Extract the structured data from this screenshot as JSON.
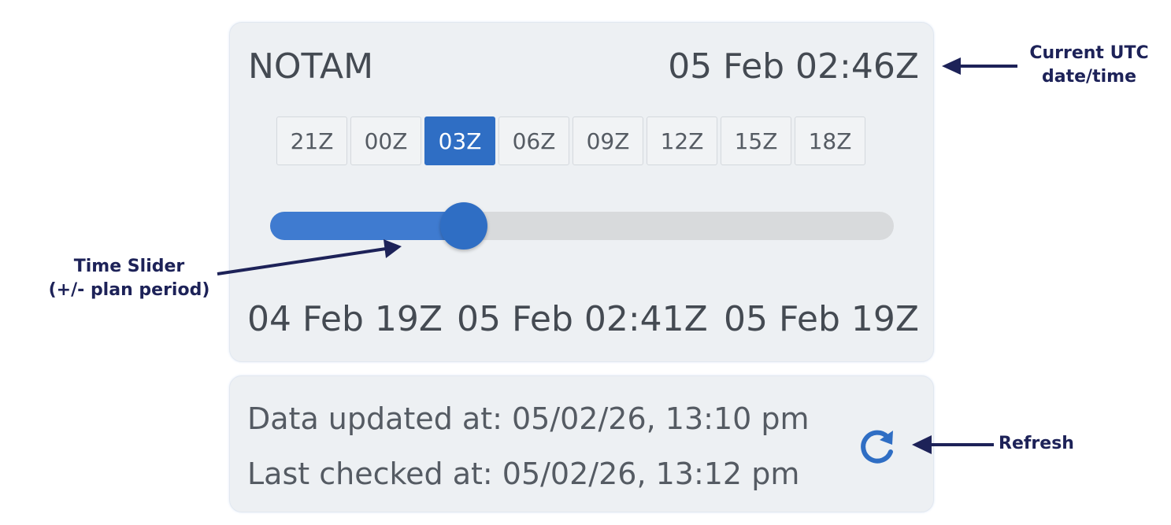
{
  "header": {
    "title": "NOTAM",
    "utc_time": "05 Feb 02:46Z"
  },
  "time_buttons": [
    {
      "label": "21Z",
      "active": false
    },
    {
      "label": "00Z",
      "active": false
    },
    {
      "label": "03Z",
      "active": true
    },
    {
      "label": "06Z",
      "active": false
    },
    {
      "label": "09Z",
      "active": false
    },
    {
      "label": "12Z",
      "active": false
    },
    {
      "label": "15Z",
      "active": false
    },
    {
      "label": "18Z",
      "active": false
    }
  ],
  "slider": {
    "start_label": "04 Feb 19Z",
    "current_label": "05 Feb 02:41Z",
    "end_label": "05 Feb 19Z",
    "value_fraction": 0.31
  },
  "status": {
    "updated": "Data updated at: 05/02/26, 13:10 pm",
    "checked": "Last checked at: 05/02/26, 13:12 pm",
    "refresh_icon": "refresh-icon"
  },
  "annotations": {
    "utc": "Current UTC date/time",
    "slider_line1": "Time Slider",
    "slider_line2": "(+/- plan period)",
    "refresh": "Refresh"
  },
  "colors": {
    "accent": "#2f6ec4",
    "panel_bg": "#edf0f3",
    "annotation": "#1d2258"
  }
}
